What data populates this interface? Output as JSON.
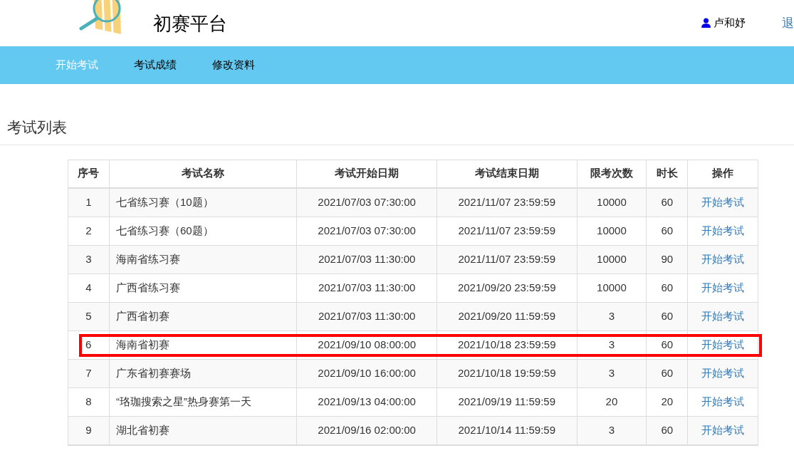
{
  "header": {
    "title": "初赛平台",
    "user": "卢和妤",
    "logout": "退"
  },
  "nav": [
    {
      "label": "开始考试",
      "selected": true
    },
    {
      "label": "考试成绩",
      "selected": false
    },
    {
      "label": "修改资料",
      "selected": false
    }
  ],
  "section_title": "考试列表",
  "table": {
    "columns": [
      "序号",
      "考试名称",
      "考试开始日期",
      "考试结束日期",
      "限考次数",
      "时长",
      "操作"
    ],
    "rows": [
      {
        "cells": [
          "1",
          "七省练习赛（10题）",
          "2021/07/03 07:30:00",
          "2021/11/07 23:59:59",
          "10000",
          "60"
        ],
        "action": "开始考试",
        "highlighted": false
      },
      {
        "cells": [
          "2",
          "七省练习赛（60题）",
          "2021/07/03 07:30:00",
          "2021/11/07 23:59:59",
          "10000",
          "60"
        ],
        "action": "开始考试",
        "highlighted": false
      },
      {
        "cells": [
          "3",
          "海南省练习赛",
          "2021/07/03 11:30:00",
          "2021/11/07 23:59:59",
          "10000",
          "90"
        ],
        "action": "开始考试",
        "highlighted": false
      },
      {
        "cells": [
          "4",
          "广西省练习赛",
          "2021/07/03 11:30:00",
          "2021/09/20 23:59:59",
          "10000",
          "60"
        ],
        "action": "开始考试",
        "highlighted": false
      },
      {
        "cells": [
          "5",
          "广西省初赛",
          "2021/07/03 11:30:00",
          "2021/09/20 11:59:59",
          "3",
          "60"
        ],
        "action": "开始考试",
        "highlighted": false
      },
      {
        "cells": [
          "6",
          "海南省初赛",
          "2021/09/10 08:00:00",
          "2021/10/18 23:59:59",
          "3",
          "60"
        ],
        "action": "开始考试",
        "highlighted": true
      },
      {
        "cells": [
          "7",
          "广东省初赛赛场",
          "2021/09/10 16:00:00",
          "2021/10/18 19:59:59",
          "3",
          "60"
        ],
        "action": "开始考试",
        "highlighted": false
      },
      {
        "cells": [
          "8",
          "“珞珈搜索之星”热身赛第一天",
          "2021/09/13 04:00:00",
          "2021/09/19 11:59:59",
          "20",
          "20"
        ],
        "action": "开始考试",
        "highlighted": false
      },
      {
        "cells": [
          "9",
          "湖北省初赛",
          "2021/09/16 02:00:00",
          "2021/10/14 11:59:59",
          "3",
          "60"
        ],
        "action": "开始考试",
        "highlighted": false
      }
    ]
  }
}
